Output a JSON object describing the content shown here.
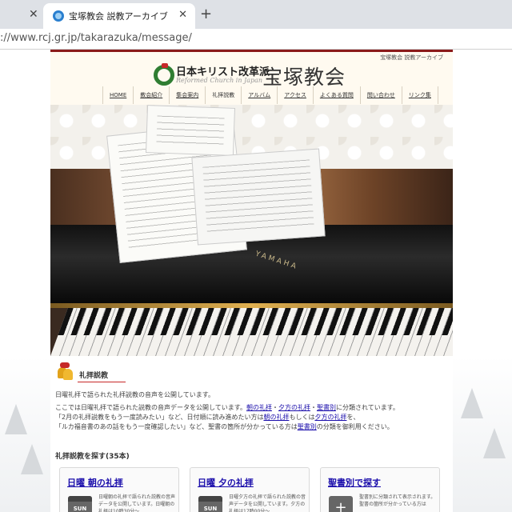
{
  "browser": {
    "tab_title": "宝塚教会 説教アーカイブ",
    "url": "://www.rcj.gr.jp/takarazuka/message/",
    "close_glyph": "✕",
    "new_tab_glyph": "+"
  },
  "header": {
    "caption": "宝塚教会 説教アーカイブ",
    "logo_jp": "日本キリスト改革派",
    "logo_en": "Reformed Church in Japan",
    "church_name": "宝塚教会"
  },
  "nav": {
    "items": [
      {
        "label": "HOME"
      },
      {
        "label": "教会紹介"
      },
      {
        "label": "集会案内"
      },
      {
        "label": "礼拝説教"
      },
      {
        "label": "アルバム"
      },
      {
        "label": "アクセス"
      },
      {
        "label": "よくある質問"
      },
      {
        "label": "問い合わせ"
      },
      {
        "label": "リンク集"
      }
    ],
    "current_index": 3
  },
  "hero": {
    "brand_text": "YAMAHA"
  },
  "section": {
    "title": "礼拝説教",
    "intro": "日曜礼拝で語られた礼拝説教の音声を公開しています。",
    "p2_pre": "ここでは日曜礼拝で語られた説教の音声データを公開しています。",
    "p2_link1": "朝の礼拝",
    "p2_sep1": "・",
    "p2_link2": "夕方の礼拝",
    "p2_sep2": "・",
    "p2_link3": "聖書別",
    "p2_post": "に分類されています。",
    "p3_pre": "「2月の礼拝説教をもう一度読みたい」など、日付順に読み進めたい方は",
    "p3_link1": "朝の礼拝",
    "p3_mid": "もしくは",
    "p3_link2": "夕方の礼拝",
    "p3_post": "を、",
    "p4_pre": "「ルカ福音書のあの話をもう一度確認したい」など、聖書の箇所が分かっている方は",
    "p4_link": "聖書別",
    "p4_post": "の分類を御利用ください。"
  },
  "search": {
    "heading": "礼拝説教を探す(35本)"
  },
  "cards": [
    {
      "title": "日曜 朝の礼拝",
      "icon_label": "SUN",
      "desc": "日曜朝の礼拝で語られた説教の音声データを公開しています。日曜朝の礼拝は10時30分～"
    },
    {
      "title": "日曜 夕の礼拝",
      "icon_label": "SUN",
      "desc": "日曜夕方の礼拝で語られた説教の音声データを公開しています。夕方の礼拝は17時00分～"
    },
    {
      "title": "聖書別で探す",
      "icon_label": "+",
      "desc": "聖書別に分類されて表示されます。聖書の箇所が分かっている方は"
    }
  ],
  "colors": {
    "accent_red": "#8b1a1a",
    "link_blue": "#1a0dab"
  }
}
